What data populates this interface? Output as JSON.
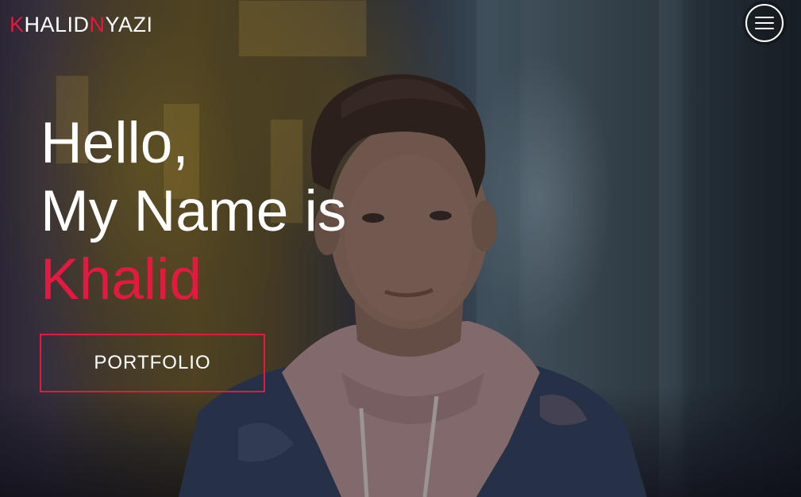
{
  "header": {
    "logo": {
      "part1": "K",
      "part2": "HALID",
      "part3": "N",
      "part4": "YAZI"
    },
    "menu_icon": "hamburger-menu-icon"
  },
  "hero": {
    "line1": "Hello,",
    "line2": "My Name is",
    "name": "Khalid",
    "cta_label": "PORTFOLIO"
  },
  "colors": {
    "accent": "#e3193f",
    "text": "#ffffff"
  }
}
